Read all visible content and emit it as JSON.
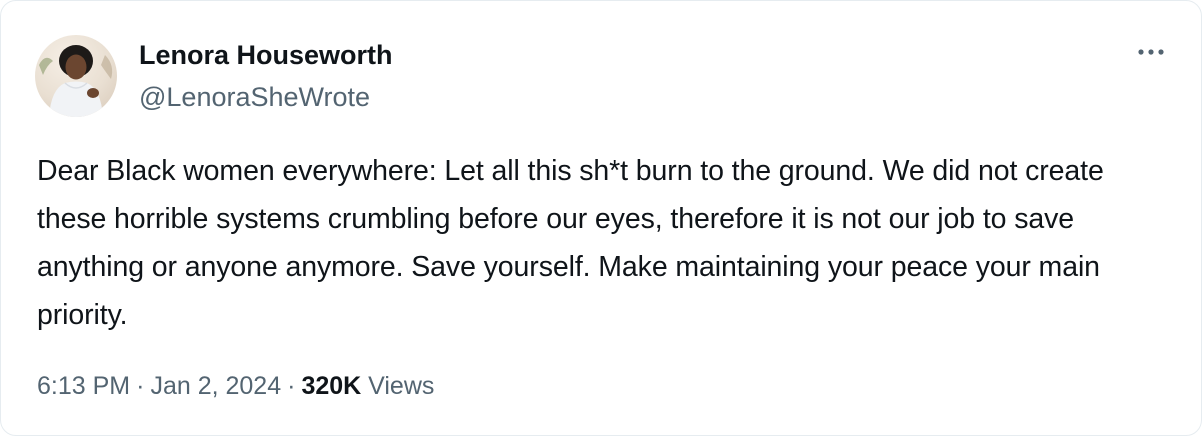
{
  "tweet": {
    "author": {
      "display_name": "Lenora Houseworth",
      "handle": "@LenoraSheWrote",
      "avatar_icon": "profile-photo"
    },
    "more_icon": "more-horizontal-icon",
    "text": "Dear Black women everywhere: Let all this sh*t burn to the ground. We did not create these horrible systems crumbling before our eyes, therefore it is not our job to save anything or anyone anymore. Save yourself. Make maintaining your peace your main priority.",
    "time": "6:13 PM",
    "separator": "·",
    "date": "Jan 2, 2024",
    "views_count": "320K",
    "views_label": "Views"
  },
  "colors": {
    "primary_text": "#0f1419",
    "secondary_text": "#536471",
    "border": "#e6ecf0",
    "background": "#ffffff"
  }
}
